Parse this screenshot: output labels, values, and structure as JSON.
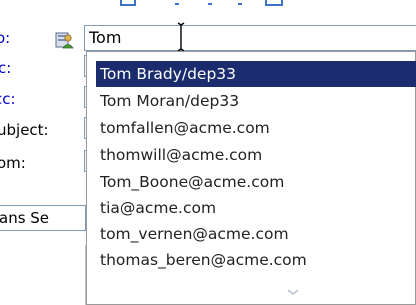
{
  "fields": {
    "to_label": "o:",
    "cc_label": "c:",
    "bcc_label": "cc:",
    "subject_label": "ubject:",
    "from_label": "om:",
    "to_value": "Tom"
  },
  "font": {
    "name": "ans Se"
  },
  "autocomplete": {
    "selected_index": 0,
    "items": [
      "Tom Brady/dep33",
      "Tom Moran/dep33",
      "tomfallen@acme.com",
      "thomwill@acme.com",
      "Tom_Boone@acme.com",
      "tia@acme.com",
      "tom_vernen@acme.com",
      "thomas_beren@acme.com"
    ]
  },
  "icons": {
    "lookup": "address-book-icon",
    "more": "chevron-down-icon",
    "cursor": "text-cursor-icon"
  },
  "colors": {
    "accent_label": "#0000cc",
    "selection": "#1b2c6e",
    "field_border": "#7f9db9"
  }
}
